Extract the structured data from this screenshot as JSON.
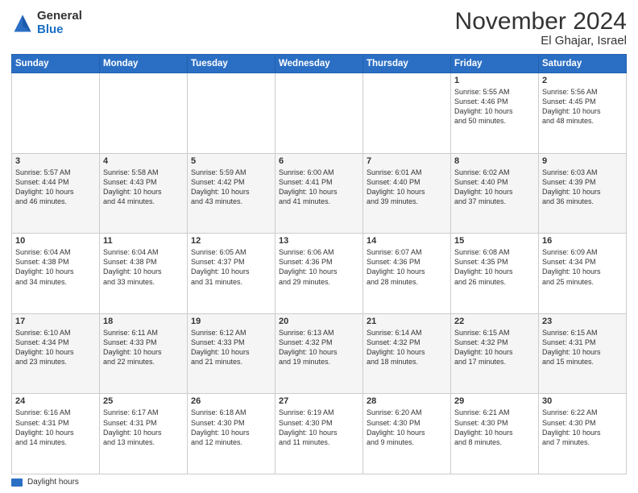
{
  "logo": {
    "general": "General",
    "blue": "Blue"
  },
  "title": "November 2024",
  "subtitle": "El Ghajar, Israel",
  "days_header": [
    "Sunday",
    "Monday",
    "Tuesday",
    "Wednesday",
    "Thursday",
    "Friday",
    "Saturday"
  ],
  "weeks": [
    [
      {
        "day": "",
        "detail": ""
      },
      {
        "day": "",
        "detail": ""
      },
      {
        "day": "",
        "detail": ""
      },
      {
        "day": "",
        "detail": ""
      },
      {
        "day": "",
        "detail": ""
      },
      {
        "day": "1",
        "detail": "Sunrise: 5:55 AM\nSunset: 4:46 PM\nDaylight: 10 hours\nand 50 minutes."
      },
      {
        "day": "2",
        "detail": "Sunrise: 5:56 AM\nSunset: 4:45 PM\nDaylight: 10 hours\nand 48 minutes."
      }
    ],
    [
      {
        "day": "3",
        "detail": "Sunrise: 5:57 AM\nSunset: 4:44 PM\nDaylight: 10 hours\nand 46 minutes."
      },
      {
        "day": "4",
        "detail": "Sunrise: 5:58 AM\nSunset: 4:43 PM\nDaylight: 10 hours\nand 44 minutes."
      },
      {
        "day": "5",
        "detail": "Sunrise: 5:59 AM\nSunset: 4:42 PM\nDaylight: 10 hours\nand 43 minutes."
      },
      {
        "day": "6",
        "detail": "Sunrise: 6:00 AM\nSunset: 4:41 PM\nDaylight: 10 hours\nand 41 minutes."
      },
      {
        "day": "7",
        "detail": "Sunrise: 6:01 AM\nSunset: 4:40 PM\nDaylight: 10 hours\nand 39 minutes."
      },
      {
        "day": "8",
        "detail": "Sunrise: 6:02 AM\nSunset: 4:40 PM\nDaylight: 10 hours\nand 37 minutes."
      },
      {
        "day": "9",
        "detail": "Sunrise: 6:03 AM\nSunset: 4:39 PM\nDaylight: 10 hours\nand 36 minutes."
      }
    ],
    [
      {
        "day": "10",
        "detail": "Sunrise: 6:04 AM\nSunset: 4:38 PM\nDaylight: 10 hours\nand 34 minutes."
      },
      {
        "day": "11",
        "detail": "Sunrise: 6:04 AM\nSunset: 4:38 PM\nDaylight: 10 hours\nand 33 minutes."
      },
      {
        "day": "12",
        "detail": "Sunrise: 6:05 AM\nSunset: 4:37 PM\nDaylight: 10 hours\nand 31 minutes."
      },
      {
        "day": "13",
        "detail": "Sunrise: 6:06 AM\nSunset: 4:36 PM\nDaylight: 10 hours\nand 29 minutes."
      },
      {
        "day": "14",
        "detail": "Sunrise: 6:07 AM\nSunset: 4:36 PM\nDaylight: 10 hours\nand 28 minutes."
      },
      {
        "day": "15",
        "detail": "Sunrise: 6:08 AM\nSunset: 4:35 PM\nDaylight: 10 hours\nand 26 minutes."
      },
      {
        "day": "16",
        "detail": "Sunrise: 6:09 AM\nSunset: 4:34 PM\nDaylight: 10 hours\nand 25 minutes."
      }
    ],
    [
      {
        "day": "17",
        "detail": "Sunrise: 6:10 AM\nSunset: 4:34 PM\nDaylight: 10 hours\nand 23 minutes."
      },
      {
        "day": "18",
        "detail": "Sunrise: 6:11 AM\nSunset: 4:33 PM\nDaylight: 10 hours\nand 22 minutes."
      },
      {
        "day": "19",
        "detail": "Sunrise: 6:12 AM\nSunset: 4:33 PM\nDaylight: 10 hours\nand 21 minutes."
      },
      {
        "day": "20",
        "detail": "Sunrise: 6:13 AM\nSunset: 4:32 PM\nDaylight: 10 hours\nand 19 minutes."
      },
      {
        "day": "21",
        "detail": "Sunrise: 6:14 AM\nSunset: 4:32 PM\nDaylight: 10 hours\nand 18 minutes."
      },
      {
        "day": "22",
        "detail": "Sunrise: 6:15 AM\nSunset: 4:32 PM\nDaylight: 10 hours\nand 17 minutes."
      },
      {
        "day": "23",
        "detail": "Sunrise: 6:15 AM\nSunset: 4:31 PM\nDaylight: 10 hours\nand 15 minutes."
      }
    ],
    [
      {
        "day": "24",
        "detail": "Sunrise: 6:16 AM\nSunset: 4:31 PM\nDaylight: 10 hours\nand 14 minutes."
      },
      {
        "day": "25",
        "detail": "Sunrise: 6:17 AM\nSunset: 4:31 PM\nDaylight: 10 hours\nand 13 minutes."
      },
      {
        "day": "26",
        "detail": "Sunrise: 6:18 AM\nSunset: 4:30 PM\nDaylight: 10 hours\nand 12 minutes."
      },
      {
        "day": "27",
        "detail": "Sunrise: 6:19 AM\nSunset: 4:30 PM\nDaylight: 10 hours\nand 11 minutes."
      },
      {
        "day": "28",
        "detail": "Sunrise: 6:20 AM\nSunset: 4:30 PM\nDaylight: 10 hours\nand 9 minutes."
      },
      {
        "day": "29",
        "detail": "Sunrise: 6:21 AM\nSunset: 4:30 PM\nDaylight: 10 hours\nand 8 minutes."
      },
      {
        "day": "30",
        "detail": "Sunrise: 6:22 AM\nSunset: 4:30 PM\nDaylight: 10 hours\nand 7 minutes."
      }
    ]
  ],
  "legend": {
    "daylight_label": "Daylight hours"
  }
}
